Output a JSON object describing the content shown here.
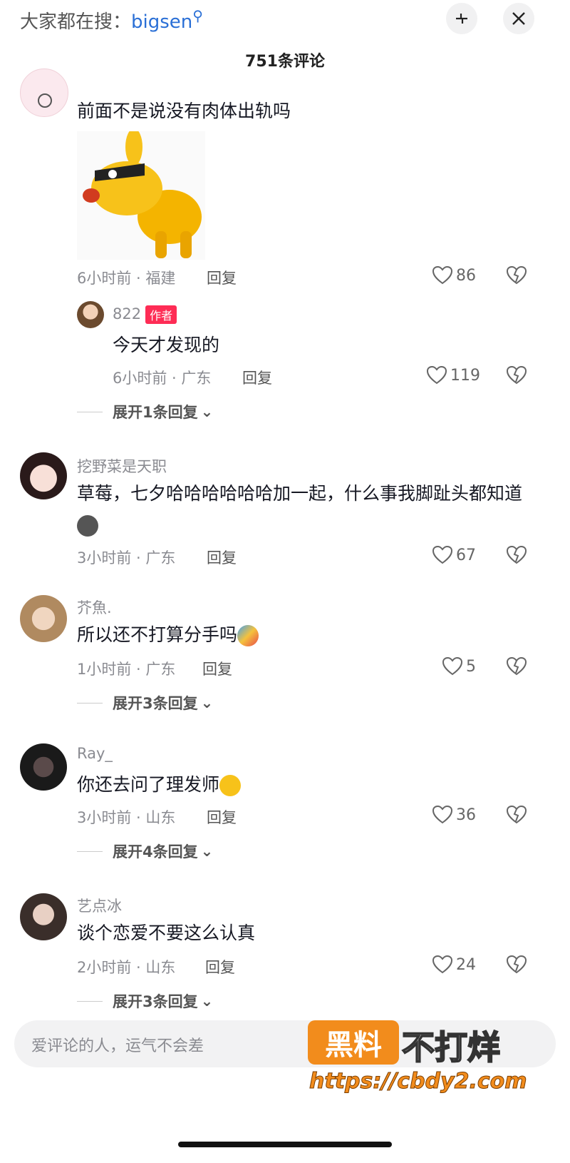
{
  "header": {
    "search_prefix": "大家都在搜：",
    "search_keyword": "bigsen",
    "title": "751条评论"
  },
  "comments": [
    {
      "text": "前面不是说没有肉体出轨吗",
      "time": "6小时前 · 福建",
      "reply": "回复",
      "likes": "86",
      "sub_reply": {
        "user": "822",
        "tag": "作者",
        "text": "今天才发现的",
        "time": "6小时前 · 广东",
        "reply": "回复",
        "likes": "119"
      },
      "expand": "展开1条回复"
    },
    {
      "user": "挖野菜是天职",
      "text": "草莓，七夕哈哈哈哈哈哈加一起，什么事我脚趾头都知道",
      "time": "3小时前 · 广东",
      "reply": "回复",
      "likes": "67"
    },
    {
      "user": "芥魚.",
      "text": "所以还不打算分手吗",
      "time": "1小时前 · 广东",
      "reply": "回复",
      "likes": "5",
      "expand": "展开3条回复"
    },
    {
      "user": "Ray_",
      "text": "你还去问了理发师",
      "time": "3小时前 · 山东",
      "reply": "回复",
      "likes": "36",
      "expand": "展开4条回复"
    },
    {
      "user": "艺点冰",
      "text": "谈个恋爱不要这么认真",
      "time": "2小时前 · 山东",
      "reply": "回复",
      "likes": "24",
      "expand": "展开3条回复"
    }
  ],
  "input": {
    "placeholder": "爱评论的人，运气不会差"
  },
  "watermark": {
    "box": "黑料",
    "text": "不打烊",
    "url": "https://cbdy2.com"
  },
  "colors": {
    "accent": "#fe2c55",
    "link": "#2a6fd6",
    "watermark": "#f28c1c"
  }
}
